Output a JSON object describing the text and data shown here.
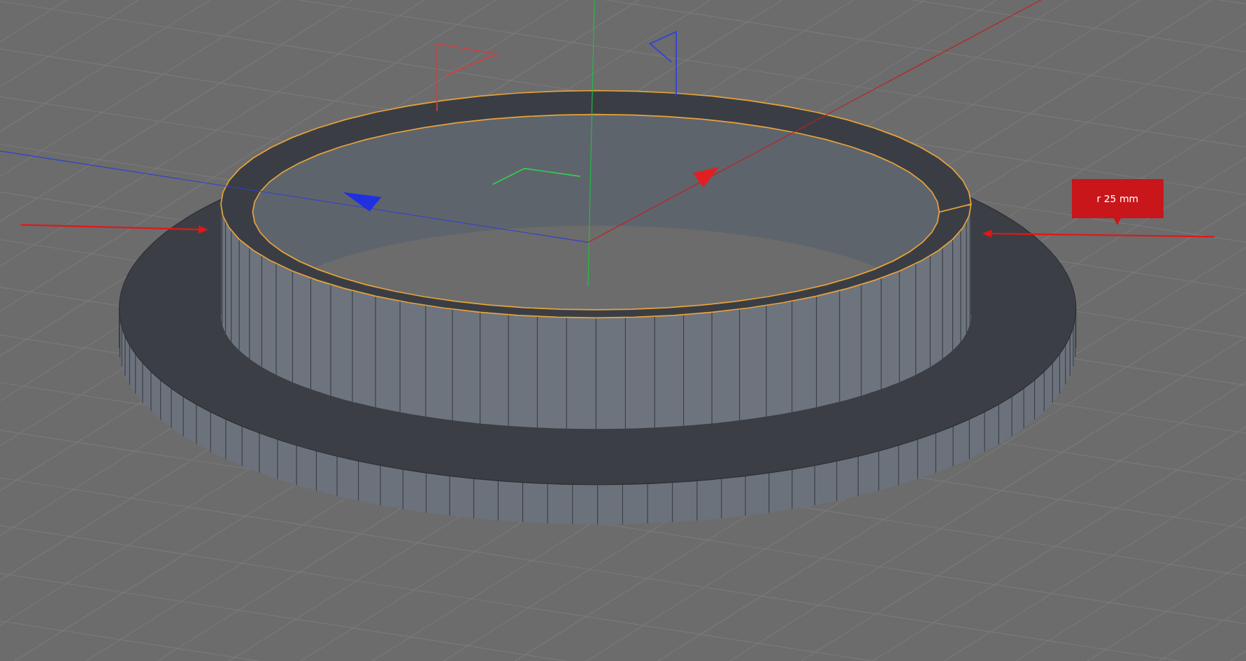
{
  "viewport": {
    "annotation": {
      "text": "r 25 mm"
    }
  }
}
